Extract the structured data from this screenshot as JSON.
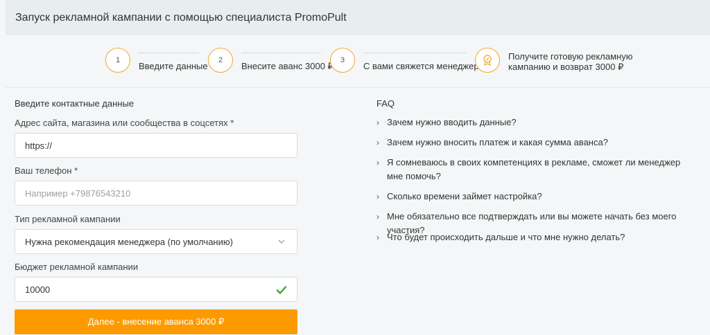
{
  "header": {
    "title": "Запуск рекламной кампании с помощью специалиста PromoPult"
  },
  "steps": [
    {
      "number": "1",
      "label": "Введите данные"
    },
    {
      "number": "2",
      "label": "Внесите аванс 3000 ₽"
    },
    {
      "number": "3",
      "label": "С вами свяжется менеджер"
    },
    {
      "icon": "award-badge-icon",
      "label": "Получите готовую рекламную кампанию и возврат 3000 ₽"
    }
  ],
  "form": {
    "title": "Введите контактные данные",
    "site_label": "Адрес сайта, магазина или сообщества в соцсетях *",
    "site_value": "https://",
    "phone_label": "Ваш телефон *",
    "phone_placeholder": "Например +79876543210",
    "campaign_type_label": "Тип рекламной кампании",
    "campaign_type_value": "Нужна рекомендация менеджера (по умолчанию)",
    "budget_label": "Бюджет рекламной кампании",
    "budget_value": "10000",
    "submit_label": "Далее - внесение аванса 3000 ₽"
  },
  "faq": {
    "title": "FAQ",
    "items": [
      "Зачем нужно вводить данные?",
      "Зачем нужно вносить платеж и какая сумма аванса?",
      "Я сомневаюсь в своих компетенциях в рекламе, сможет ли менеджер мне помочь?",
      "Сколько времени займет настройка?",
      "Мне обязательно все подтверждать или вы можете начать без моего участия?",
      "Что будет происходить дальше и что мне нужно делать?"
    ]
  },
  "colors": {
    "accent": "#fd9a00",
    "step_border": "#f3a530",
    "check": "#3aa63a",
    "header_bg": "#e8edef"
  }
}
